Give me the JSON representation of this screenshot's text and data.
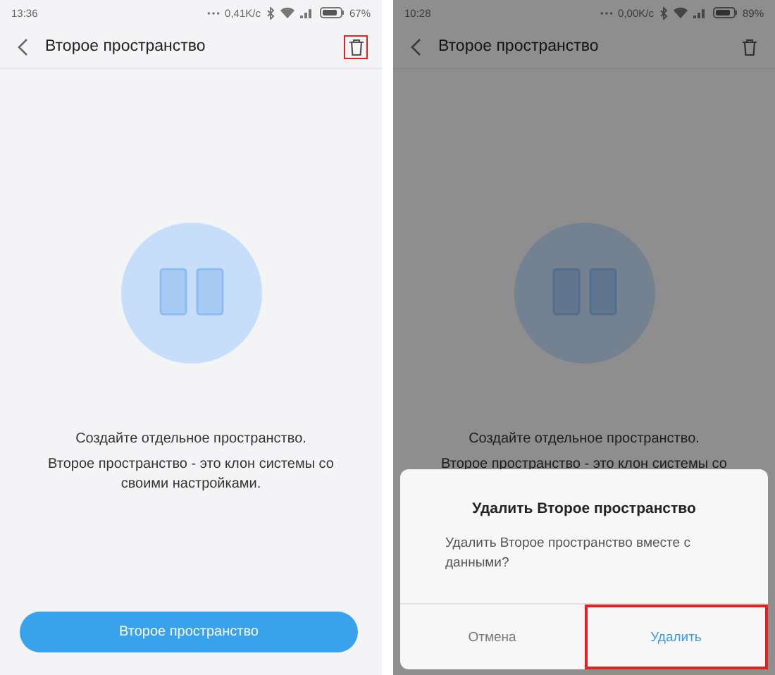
{
  "screens": [
    {
      "status": {
        "time": "13:36",
        "speed": "0,41K/c",
        "battery": "67%"
      },
      "header": {
        "title": "Второе пространство",
        "delete_highlighted": true
      },
      "description": [
        "Создайте отдельное пространство.",
        "Второе пространство - это клон системы со своими настройками."
      ],
      "button": "Второе пространство"
    },
    {
      "status": {
        "time": "10:28",
        "speed": "0,00K/c",
        "battery": "89%"
      },
      "header": {
        "title": "Второе пространство",
        "delete_highlighted": false
      },
      "description": [
        "Создайте отдельное пространство.",
        "Второе пространство - это клон системы со"
      ],
      "dialog": {
        "title": "Удалить Второе пространство",
        "message": "Удалить Второе пространство вместе с данными?",
        "buttons": [
          {
            "label": "Отмена",
            "kind": "cancel",
            "highlighted": false
          },
          {
            "label": "Удалить",
            "kind": "confirm",
            "highlighted": true
          }
        ]
      }
    }
  ]
}
